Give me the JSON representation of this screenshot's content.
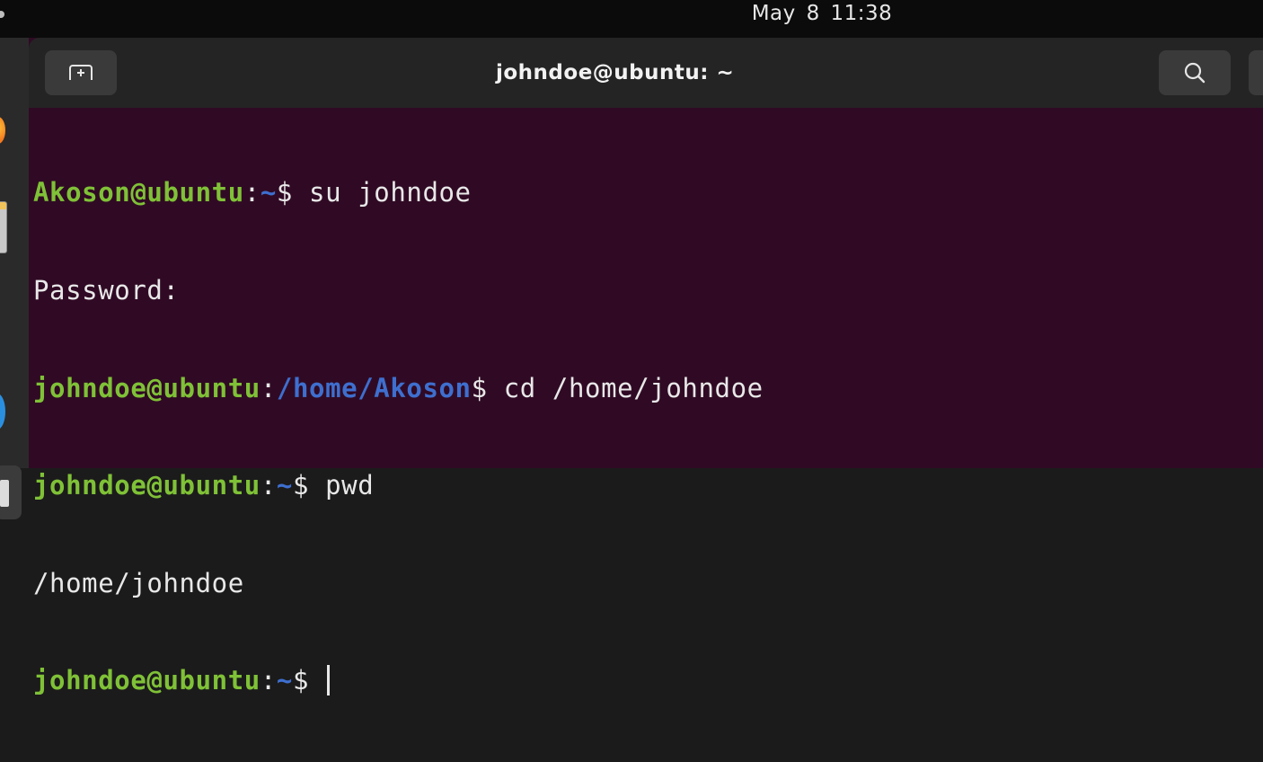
{
  "system_bar": {
    "clock": "May 8  11:38"
  },
  "dock": {
    "items": [
      {
        "icon": "firefox-icon"
      },
      {
        "icon": "files-icon"
      },
      {
        "icon": "app-store-icon"
      },
      {
        "icon": "terminal-app-icon"
      }
    ]
  },
  "window": {
    "title": "johndoe@ubuntu: ~",
    "new_tab_icon": "new-tab-icon",
    "search_icon": "search-icon"
  },
  "colors": {
    "terminal_background": "#300a24",
    "prompt_user": "#7fc137",
    "prompt_path": "#3e6fcf",
    "text": "#e8e8e8"
  },
  "terminal": {
    "lines": [
      {
        "user": "Akoson@ubuntu",
        "sep": ":",
        "path": "~",
        "suffix": "$ su johndoe"
      },
      {
        "output": "Password:"
      },
      {
        "user": "johndoe@ubuntu",
        "sep": ":",
        "path": "/home/Akoson",
        "suffix": "$ cd /home/johndoe"
      },
      {
        "user": "johndoe@ubuntu",
        "sep": ":",
        "path": "~",
        "suffix": "$ pwd"
      },
      {
        "output": "/home/johndoe"
      },
      {
        "user": "johndoe@ubuntu",
        "sep": ":",
        "path": "~",
        "suffix": "$ "
      }
    ]
  }
}
